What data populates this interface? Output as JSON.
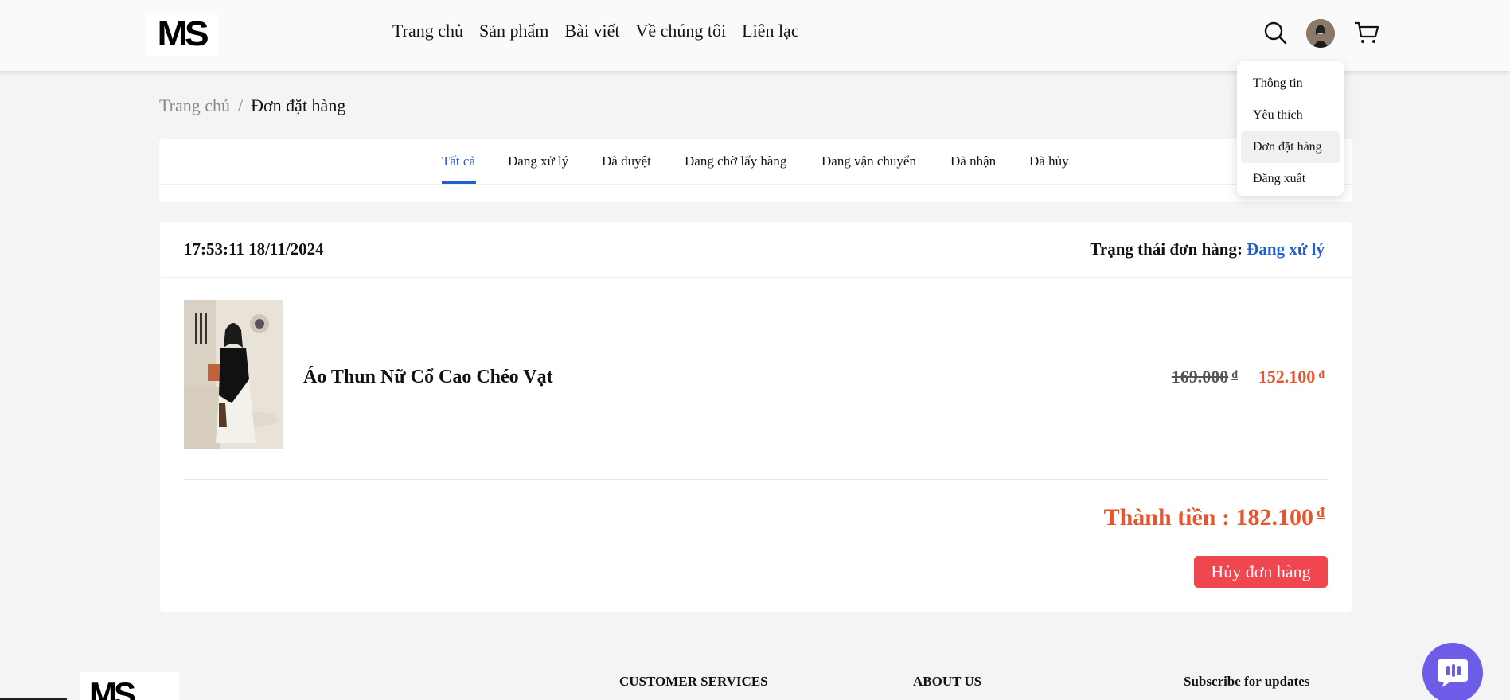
{
  "header": {
    "logo": "MS",
    "nav": [
      "Trang chủ",
      "Sản phẩm",
      "Bài viết",
      "Về chúng tôi",
      "Liên lạc"
    ]
  },
  "user_menu": {
    "items": [
      "Thông tin",
      "Yêu thích",
      "Đơn đặt hàng",
      "Đăng xuất"
    ],
    "active": "Đơn đặt hàng"
  },
  "breadcrumb": {
    "home": "Trang chủ",
    "separator": "/",
    "current": "Đơn đặt hàng"
  },
  "tabs": [
    "Tất cả",
    "Đang xử lý",
    "Đã duyệt",
    "Đang chờ lấy hàng",
    "Đang vận chuyển",
    "Đã nhận",
    "Đã hủy"
  ],
  "active_tab": "Tất cả",
  "order": {
    "time": "17:53:11 18/11/2024",
    "status_label": "Trạng thái đơn hàng:",
    "status_value": "Đang xử lý",
    "product_name": "Áo Thun Nữ Cổ Cao Chéo Vạt",
    "price_original": "169.000",
    "price_sale": "152.100",
    "currency": "đ",
    "total_label": "Thành tiền :",
    "total": "182.100",
    "cancel_label": "Hủy đơn hàng"
  },
  "footer": {
    "logo": "MS",
    "headings": [
      "CUSTOMER SERVICES",
      "ABOUT US",
      "Subscribe for updates"
    ]
  },
  "colors": {
    "accent_blue": "#1f5fd6",
    "price_orange": "#e8542c",
    "cancel_red": "#f0464f",
    "chat_purple": "#6c5ce7"
  },
  "icons": [
    "search-icon",
    "avatar",
    "cart-icon",
    "chat-icon"
  ]
}
